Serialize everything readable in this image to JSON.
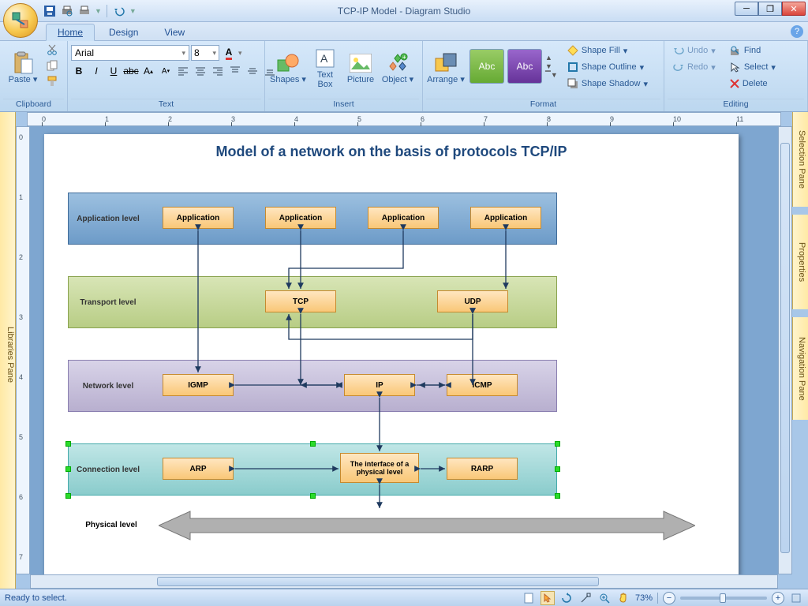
{
  "window": {
    "title": "TCP-IP Model - Diagram Studio"
  },
  "tabs": {
    "home": "Home",
    "design": "Design",
    "view": "View"
  },
  "ribbon": {
    "clipboard": {
      "label": "Clipboard",
      "paste": "Paste"
    },
    "text": {
      "label": "Text",
      "font": "Arial",
      "size": "8"
    },
    "insert": {
      "label": "Insert",
      "shapes": "Shapes",
      "textbox": "Text\nBox",
      "picture": "Picture",
      "object": "Object"
    },
    "format": {
      "label": "Format",
      "arrange": "Arrange",
      "abc": "Abc",
      "fill": "Shape Fill",
      "outline": "Shape Outline",
      "shadow": "Shape Shadow"
    },
    "editing": {
      "label": "Editing",
      "undo": "Undo",
      "redo": "Redo",
      "find": "Find",
      "select": "Select",
      "delete": "Delete"
    }
  },
  "panes": {
    "left": "Libraries Pane",
    "r1": "Selection Pane",
    "r2": "Properties",
    "r3": "Navigation Pane"
  },
  "diagram": {
    "title": "Model of a network on the basis of protocols TCP/IP",
    "layers": {
      "app": "Application level",
      "trans": "Transport level",
      "net": "Network level",
      "conn": "Connection level",
      "phys": "Physical level"
    },
    "nodes": {
      "app1": "Application",
      "app2": "Application",
      "app3": "Application",
      "app4": "Application",
      "tcp": "TCP",
      "udp": "UDP",
      "igmp": "IGMP",
      "ip": "IP",
      "icmp": "ICMP",
      "arp": "ARP",
      "iface": "The interface of a physical level",
      "rarp": "RARP"
    }
  },
  "status": {
    "msg": "Ready to select.",
    "zoom": "73%"
  }
}
